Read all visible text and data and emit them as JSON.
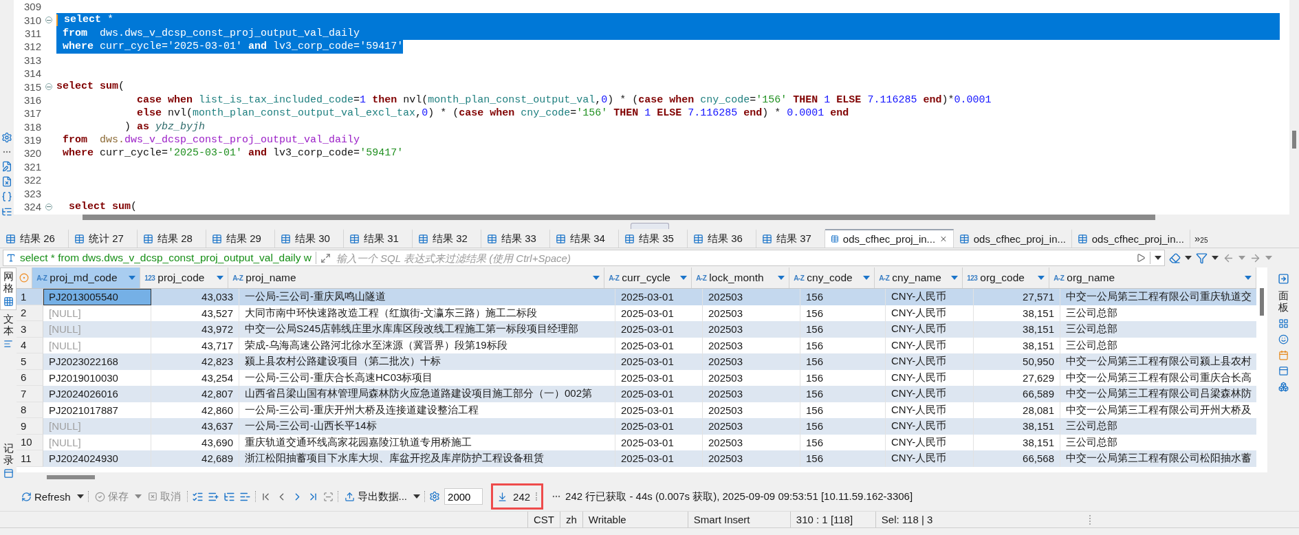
{
  "editor": {
    "lines": [
      {
        "number": "309",
        "fold": false,
        "selected": false,
        "caret": false
      },
      {
        "number": "310",
        "fold": true,
        "selected": true,
        "caret": true,
        "tokens": [
          {
            "kind": "kw",
            "text": " select"
          },
          {
            "kind": "plain",
            "text": " *"
          }
        ]
      },
      {
        "number": "311",
        "fold": false,
        "selected": true,
        "caret": false,
        "tokens": [
          {
            "kind": "kw",
            "text": " from"
          },
          {
            "kind": "plain",
            "text": "  dws.dws_v_dcsp_const_proj_output_val_daily"
          }
        ]
      },
      {
        "number": "312",
        "fold": false,
        "selected": true,
        "caret": false,
        "tokens": [
          {
            "kind": "kw",
            "text": " where"
          },
          {
            "kind": "plain",
            "text": " curr_cycle="
          },
          {
            "kind": "str",
            "text": "'2025-03-01'"
          },
          {
            "kind": "kw",
            "text": " and"
          },
          {
            "kind": "plain",
            "text": " lv3_corp_code="
          },
          {
            "kind": "str",
            "text": "'59417'"
          }
        ]
      },
      {
        "number": "313",
        "fold": false,
        "selected": false,
        "caret": false
      },
      {
        "number": "314",
        "fold": false,
        "selected": false,
        "caret": false
      },
      {
        "number": "315",
        "fold": true,
        "selected": false,
        "caret": false,
        "tokens": [
          {
            "kind": "kw",
            "text": "select"
          },
          {
            "kind": "kw",
            "text": " sum"
          },
          {
            "kind": "plain",
            "text": "("
          }
        ]
      },
      {
        "number": "316",
        "fold": false,
        "selected": false,
        "caret": false,
        "tokens": [
          {
            "kind": "kw",
            "text": "             case"
          },
          {
            "kind": "kw",
            "text": " when"
          },
          {
            "kind": "col",
            "text": " list_is_tax_included_code"
          },
          {
            "kind": "plain",
            "text": "="
          },
          {
            "kind": "num",
            "text": "1"
          },
          {
            "kind": "kw",
            "text": " then"
          },
          {
            "kind": "plain",
            "text": " nvl("
          },
          {
            "kind": "col",
            "text": "month_plan_const_output_val"
          },
          {
            "kind": "plain",
            "text": ","
          },
          {
            "kind": "num",
            "text": "0"
          },
          {
            "kind": "plain",
            "text": ") * ("
          },
          {
            "kind": "kw",
            "text": "case"
          },
          {
            "kind": "kw",
            "text": " when"
          },
          {
            "kind": "col",
            "text": " cny_code"
          },
          {
            "kind": "plain",
            "text": "="
          },
          {
            "kind": "str",
            "text": "'156'"
          },
          {
            "kind": "kw",
            "text": " THEN"
          },
          {
            "kind": "num",
            "text": " 1"
          },
          {
            "kind": "kw",
            "text": " ELSE"
          },
          {
            "kind": "num",
            "text": " 7.116285"
          },
          {
            "kind": "kw",
            "text": " end"
          },
          {
            "kind": "plain",
            "text": ")*"
          },
          {
            "kind": "num",
            "text": "0.0001"
          }
        ]
      },
      {
        "number": "317",
        "fold": false,
        "selected": false,
        "caret": false,
        "tokens": [
          {
            "kind": "kw",
            "text": "             else"
          },
          {
            "kind": "plain",
            "text": " nvl("
          },
          {
            "kind": "col",
            "text": "month_plan_const_output_val_excl_tax"
          },
          {
            "kind": "plain",
            "text": ","
          },
          {
            "kind": "num",
            "text": "0"
          },
          {
            "kind": "plain",
            "text": ") * ("
          },
          {
            "kind": "kw",
            "text": "case"
          },
          {
            "kind": "kw",
            "text": " when"
          },
          {
            "kind": "col",
            "text": " cny_code"
          },
          {
            "kind": "plain",
            "text": "="
          },
          {
            "kind": "str",
            "text": "'156'"
          },
          {
            "kind": "kw",
            "text": " THEN"
          },
          {
            "kind": "num",
            "text": " 1"
          },
          {
            "kind": "kw",
            "text": " ELSE"
          },
          {
            "kind": "num",
            "text": " 7.116285"
          },
          {
            "kind": "kw",
            "text": " end"
          },
          {
            "kind": "plain",
            "text": ") * "
          },
          {
            "kind": "num",
            "text": "0.0001"
          },
          {
            "kind": "kw",
            "text": " end"
          }
        ]
      },
      {
        "number": "318",
        "fold": false,
        "selected": false,
        "caret": false,
        "tokens": [
          {
            "kind": "plain",
            "text": "           ) "
          },
          {
            "kind": "kw",
            "text": "as"
          },
          {
            "kind": "alias",
            "text": " ybz_byjh"
          }
        ]
      },
      {
        "number": "319",
        "fold": false,
        "selected": false,
        "caret": false,
        "tokens": [
          {
            "kind": "kw",
            "text": " from"
          },
          {
            "kind": "schema",
            "text": "  dws."
          },
          {
            "kind": "table",
            "text": "dws_v_dcsp_const_proj_output_val_daily"
          }
        ]
      },
      {
        "number": "320",
        "fold": false,
        "selected": false,
        "caret": false,
        "tokens": [
          {
            "kind": "kw",
            "text": " where"
          },
          {
            "kind": "plain",
            "text": " curr_cycle="
          },
          {
            "kind": "str",
            "text": "'2025-03-01'"
          },
          {
            "kind": "kw",
            "text": " and"
          },
          {
            "kind": "plain",
            "text": " lv3_corp_code="
          },
          {
            "kind": "str",
            "text": "'59417'"
          }
        ]
      },
      {
        "number": "321",
        "fold": false,
        "selected": false,
        "caret": false
      },
      {
        "number": "322",
        "fold": false,
        "selected": false,
        "caret": false
      },
      {
        "number": "323",
        "fold": false,
        "selected": false,
        "caret": false
      },
      {
        "number": "324",
        "fold": true,
        "selected": false,
        "caret": false,
        "tokens": [
          {
            "kind": "kw",
            "text": "  select"
          },
          {
            "kind": "kw",
            "text": " sum"
          },
          {
            "kind": "plain",
            "text": "("
          }
        ]
      }
    ]
  },
  "result_tabs": [
    {
      "label": "结果 26",
      "selected": false,
      "closable": false
    },
    {
      "label": "统计 27",
      "selected": false,
      "closable": false
    },
    {
      "label": "结果 28",
      "selected": false,
      "closable": false
    },
    {
      "label": "结果 29",
      "selected": false,
      "closable": false
    },
    {
      "label": "结果 30",
      "selected": false,
      "closable": false
    },
    {
      "label": "结果 31",
      "selected": false,
      "closable": false
    },
    {
      "label": "结果 32",
      "selected": false,
      "closable": false
    },
    {
      "label": "结果 33",
      "selected": false,
      "closable": false
    },
    {
      "label": "结果 34",
      "selected": false,
      "closable": false
    },
    {
      "label": "结果 35",
      "selected": false,
      "closable": false
    },
    {
      "label": "结果 36",
      "selected": false,
      "closable": false
    },
    {
      "label": "结果 37",
      "selected": false,
      "closable": false
    },
    {
      "label": "ods_cfhec_proj_in...",
      "selected": true,
      "closable": true
    },
    {
      "label": "ods_cfhec_proj_in...",
      "selected": false,
      "closable": false
    },
    {
      "label": "ods_cfhec_proj_in...",
      "selected": false,
      "closable": false
    }
  ],
  "tabs_overflow": {
    "glyph": "»",
    "count": "25"
  },
  "filter": {
    "query": "select * from dws.dws_v_dcsp_const_proj_output_val_daily w",
    "placeholder": "输入一个 SQL 表达式来过滤结果 (使用 Ctrl+Space)"
  },
  "side_tabs": [
    {
      "label": "网格",
      "selected": true
    },
    {
      "label": "文本",
      "selected": false
    }
  ],
  "record_toggle": "记录",
  "right_panel": {
    "label": "面板"
  },
  "table": {
    "columns": [
      {
        "name": "proj_md_code",
        "type_label": "A-Z",
        "kind": "text",
        "selected": true
      },
      {
        "name": "proj_code",
        "type_label": "123",
        "kind": "number",
        "selected": false
      },
      {
        "name": "proj_name",
        "type_label": "A-Z",
        "kind": "text",
        "selected": false
      },
      {
        "name": "curr_cycle",
        "type_label": "A-Z",
        "kind": "text",
        "selected": false
      },
      {
        "name": "lock_month",
        "type_label": "A-Z",
        "kind": "text",
        "selected": false
      },
      {
        "name": "cny_code",
        "type_label": "A-Z",
        "kind": "text",
        "selected": false
      },
      {
        "name": "cny_name",
        "type_label": "A-Z",
        "kind": "text",
        "selected": false
      },
      {
        "name": "org_code",
        "type_label": "123",
        "kind": "number",
        "selected": false
      },
      {
        "name": "org_name",
        "type_label": "A-Z",
        "kind": "text",
        "selected": false
      }
    ],
    "rows": [
      {
        "number": "1",
        "selected": true,
        "md_code_null": false,
        "cells": [
          "PJ2013005540",
          "43,033",
          "一公局-三公司-重庆凤鸣山隧道",
          "2025-03-01",
          "202503",
          "156",
          "CNY-人民币",
          "27,571",
          "中交一公局第三工程有限公司重庆轨道交"
        ]
      },
      {
        "number": "2",
        "selected": false,
        "md_code_null": true,
        "cells": [
          "[NULL]",
          "43,527",
          "大同市南中环快速路改造工程（红旗街-文瀛东三路）施工二标段",
          "2025-03-01",
          "202503",
          "156",
          "CNY-人民币",
          "38,151",
          "三公司总部"
        ]
      },
      {
        "number": "3",
        "selected": false,
        "md_code_null": true,
        "cells": [
          "[NULL]",
          "43,972",
          "中交一公局S245店韩线庄里水库库区段改线工程施工第一标段项目经理部",
          "2025-03-01",
          "202503",
          "156",
          "CNY-人民币",
          "38,151",
          "三公司总部"
        ]
      },
      {
        "number": "4",
        "selected": false,
        "md_code_null": true,
        "cells": [
          "[NULL]",
          "43,717",
          "荣成-乌海高速公路河北徐水至涞源（冀晋界）段第19标段",
          "2025-03-01",
          "202503",
          "156",
          "CNY-人民币",
          "38,151",
          "三公司总部"
        ]
      },
      {
        "number": "5",
        "selected": false,
        "md_code_null": false,
        "cells": [
          "PJ2023022168",
          "42,823",
          "颍上县农村公路建设项目（第二批次）十标",
          "2025-03-01",
          "202503",
          "156",
          "CNY-人民币",
          "50,950",
          "中交一公局第三工程有限公司颍上县农村"
        ]
      },
      {
        "number": "6",
        "selected": false,
        "md_code_null": false,
        "cells": [
          "PJ2019010030",
          "43,254",
          "一公局-三公司-重庆合长高速HC03标项目",
          "2025-03-01",
          "202503",
          "156",
          "CNY-人民币",
          "27,629",
          "中交一公局第三工程有限公司重庆合长高"
        ]
      },
      {
        "number": "7",
        "selected": false,
        "md_code_null": false,
        "cells": [
          "PJ2024026016",
          "42,807",
          "山西省吕梁山国有林管理局森林防火应急道路建设项目施工部分（一）002第",
          "2025-03-01",
          "202503",
          "156",
          "CNY-人民币",
          "66,589",
          "中交一公局第三工程有限公司吕梁森林防"
        ]
      },
      {
        "number": "8",
        "selected": false,
        "md_code_null": false,
        "cells": [
          "PJ2021017887",
          "42,860",
          "一公局-三公司-重庆开州大桥及连接道建设整治工程",
          "2025-03-01",
          "202503",
          "156",
          "CNY-人民币",
          "28,081",
          "中交一公局第三工程有限公司开州大桥及"
        ]
      },
      {
        "number": "9",
        "selected": false,
        "md_code_null": true,
        "cells": [
          "[NULL]",
          "43,637",
          "一公局-三公司-山西长平14标",
          "2025-03-01",
          "202503",
          "156",
          "CNY-人民币",
          "38,151",
          "三公司总部"
        ]
      },
      {
        "number": "10",
        "selected": false,
        "md_code_null": true,
        "cells": [
          "[NULL]",
          "43,690",
          "重庆轨道交通环线高家花园嘉陵江轨道专用桥施工",
          "2025-03-01",
          "202503",
          "156",
          "CNY-人民币",
          "38,151",
          "三公司总部"
        ]
      },
      {
        "number": "11",
        "selected": false,
        "md_code_null": false,
        "cells": [
          "PJ2024024930",
          "42,689",
          "浙江松阳抽蓄项目下水库大坝、库盆开挖及库岸防护工程设备租赁",
          "2025-03-01",
          "202503",
          "156",
          "CNY-人民币",
          "66,568",
          "中交一公局第三工程有限公司松阳抽水蓄"
        ]
      }
    ]
  },
  "toolbar": {
    "refresh": "Refresh",
    "save": {
      "label": "保存",
      "disabled": true
    },
    "cancel": {
      "label": "取消",
      "disabled": true
    },
    "export": "导出数据...",
    "fetch_size": "2000",
    "row_count": "242",
    "status": "242 行已获取 - 44s (0.007s 获取), 2025-09-09 09:53:51 [10.11.59.162-3306]"
  },
  "status_bar": [
    "CST",
    "zh",
    "Writable",
    "Smart Insert",
    "310 : 1 [118]",
    "Sel: 118 | 3"
  ]
}
